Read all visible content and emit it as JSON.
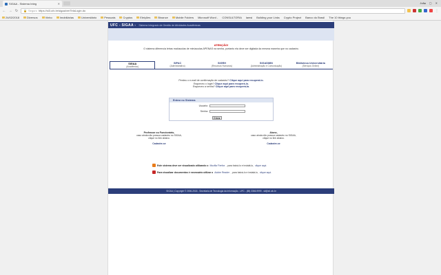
{
  "browser": {
    "tab_title": "SIGAA - Sistema Integ",
    "user": "João",
    "window_controls": "– ▢ ✕",
    "secure_label": "Seguro",
    "url": "https://si3.ufc.br/sigaa/verTelaLogin.do",
    "bookmarks": [
      {
        "label": "24/02/2018",
        "icon": "folder"
      },
      {
        "label": "Diversos",
        "icon": "folder"
      },
      {
        "label": "Vinho",
        "icon": "folder"
      },
      {
        "label": "Imobiliárias",
        "icon": "folder"
      },
      {
        "label": "Universitário",
        "icon": "folder"
      },
      {
        "label": "Pessoais",
        "icon": "folder"
      },
      {
        "label": "Cryptos",
        "icon": "folder"
      },
      {
        "label": "Eleições",
        "icon": "folder"
      },
      {
        "label": "Binance",
        "icon": "folder"
      },
      {
        "label": "Mobile Folders",
        "icon": "folder"
      },
      {
        "label": "Microsoft Word -",
        "icon": "page"
      },
      {
        "label": "CONSULTORIA",
        "icon": "page"
      },
      {
        "label": "lamsi",
        "icon": "page"
      },
      {
        "label": "Building your Links",
        "icon": "page"
      },
      {
        "label": "Crypto Project",
        "icon": "page"
      },
      {
        "label": "Banco do Brasil",
        "icon": "page"
      },
      {
        "label": "The 10 things you",
        "icon": "page"
      }
    ]
  },
  "sigaa": {
    "logo": "UFC - SIGAA -",
    "subtitle": "Sistema Integrado de Gestão de Atividades Acadêmicas",
    "warning_title": "ATENÇÃO!",
    "warning_text": "O sistema diferencia letras maiúsculas de minúsculas APENAS na senha, portanto ela deve ser digitada da mesma maneira que no cadastro.",
    "tabs": [
      {
        "name": "SIGAA",
        "desc": "(Acadêmico)",
        "active": true
      },
      {
        "name": "SIPAC",
        "desc": "(Administrativo)",
        "active": false
      },
      {
        "name": "SIGRH",
        "desc": "(Recursos Humanos)",
        "active": false
      },
      {
        "name": "SIGADMIN",
        "desc": "(Administração e Comunicação)",
        "active": false
      },
      {
        "name": "Biblioteca Universitária",
        "desc": "(Serviços Online)",
        "active": false
      }
    ],
    "forgot": {
      "line1_text": "Perdeu o e-mail de confirmação de cadastro?",
      "line1_link": "Clique aqui para recuperá-lo.",
      "line2_text": "Esqueceu o login?",
      "line2_link": "Clique aqui para recuperá-lo.",
      "line3_text": "Esqueceu a senha?",
      "line3_link": "Clique aqui para recuperá-la."
    },
    "login": {
      "header": "Entrar no Sistema",
      "user_label": "Usuário:",
      "user_value": "",
      "pass_label": "Senha:",
      "pass_value": "",
      "enter_label": "Entrar"
    },
    "professor": {
      "title": "Professor ou Funcionário,",
      "text1": "caso ainda não possua cadastro no SIGAA,",
      "text2": "clique no link abaixo.",
      "link": "Cadastre-se"
    },
    "student": {
      "title": "Aluno,",
      "text1": "caso ainda não possua cadastro no SIGAA,",
      "text2": "clique no link abaixo.",
      "link": "Cadastre-se"
    },
    "note1": {
      "bold": "Este sistema deve ser visualizado utilizando o",
      "link1": "Mozilla Firefox",
      "mid": ", para baixá-lo e instalá-lo,",
      "link2": "clique aqui."
    },
    "note2": {
      "bold": "Para visualizar documentos é necessário utilizar o",
      "link1": "Adobe Reader",
      "mid": ", para baixá-lo e instalá-lo,",
      "link2": "clique aqui."
    },
    "footer": "SIGAA | Copyright © 2006-2018 - Secretaria de Tecnologia da Informação - UFC - (85) 3366-9999 - sti@sti.ufc.br"
  },
  "colors": {
    "brand": "#2c3e7a",
    "warning": "#cc0000"
  }
}
